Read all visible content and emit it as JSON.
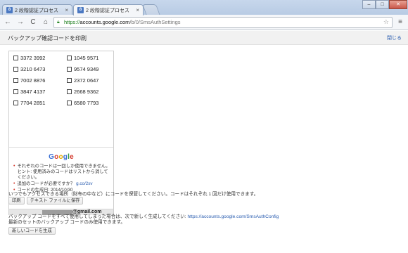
{
  "tabs": [
    {
      "title": "2 段階認証プロセス",
      "favicon": "8",
      "active": false
    },
    {
      "title": "2 段階認証プロセス",
      "favicon": "8",
      "active": true
    }
  ],
  "window_controls": {
    "minimize": "–",
    "maximize": "□",
    "close": "✕"
  },
  "toolbar": {
    "back": "←",
    "forward": "→",
    "reload": "C",
    "home": "⌂",
    "url_scheme": "https://",
    "url_host": "accounts.google.com",
    "url_path": "/b/0/SmsAuthSettings",
    "star": "☆",
    "menu": "≡"
  },
  "page": {
    "title": "バックアップ確認コードを印刷",
    "close_link": "閉じる",
    "codes": [
      "3372 3992",
      "1045 9571",
      "3210 6473",
      "9574 9349",
      "7002 8876",
      "2372 0647",
      "3847 4137",
      "2668 9362",
      "7704 2851",
      "6580 7793"
    ],
    "logo": [
      "G",
      "o",
      "o",
      "g",
      "l",
      "e"
    ],
    "notes": [
      {
        "text": "それぞれのコードは一回しか使用できません。 ヒント: 使用済みのコードはリストから消してください。"
      },
      {
        "text": "追加のコードが必要ですか？",
        "link": "g.co/2sv"
      },
      {
        "text": "コードの生成日: 2014/10/30"
      }
    ],
    "email_domain": "@gmail.com",
    "instructions": "いつでもアクセスできる場所（財布の中など）にコードを保管してください。コードはそれぞれ 1 回だけ使用できます。",
    "print_button": "印刷",
    "save_button": "テキスト ファイルに保存",
    "used_all_text": "バックアップ コードをすべて使用してしまった場合は、次で新しく生成してください:",
    "used_all_link": "https://accounts.google.com/SmsAuthConfig",
    "latest_set_text": "最新のセットのバックアップ コードのみ使用できます。",
    "generate_button": "新しいコードを生成"
  }
}
